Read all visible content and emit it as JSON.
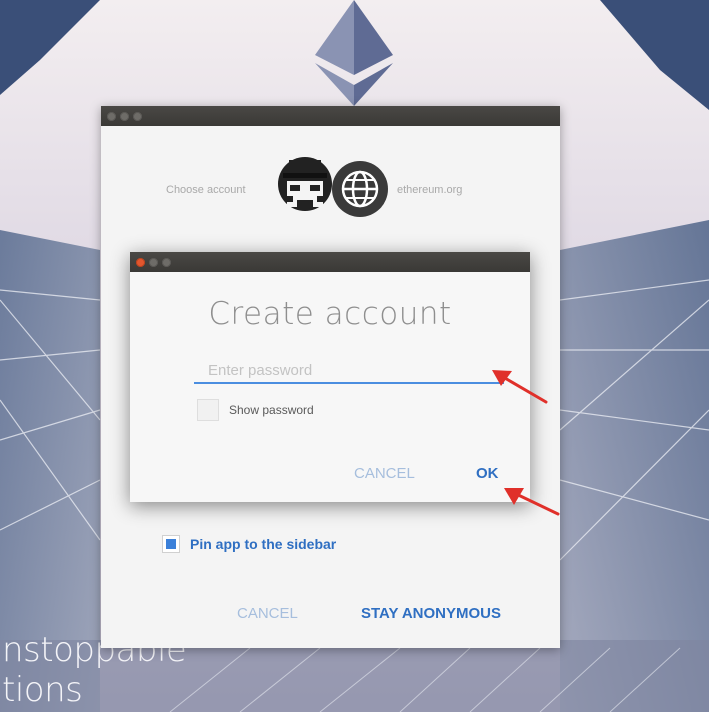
{
  "background": {
    "lines": [
      "nstoppable",
      "tions"
    ]
  },
  "outer_window": {
    "choose_account_label": "Choose account",
    "ethereum_label": "ethereum.org",
    "pin_label": "Pin app to the sidebar",
    "pin_checked": true,
    "cancel_label": "CANCEL",
    "stay_anonymous_label": "STAY ANONYMOUS",
    "icons": [
      "spy-avatar-icon",
      "globe-icon",
      "ethereum-logo-icon"
    ]
  },
  "dialog": {
    "title": "Create account",
    "password_placeholder": "Enter password",
    "password_value": "",
    "show_password_label": "Show password",
    "show_password_checked": false,
    "cancel_label": "CANCEL",
    "ok_label": "OK"
  },
  "annotations": {
    "arrow_color": "#e0302a",
    "arrows": [
      "arrow-to-password-field",
      "arrow-to-ok-button"
    ]
  },
  "colors": {
    "accent": "#2f6fc2",
    "titlebar": "#3e3d3a",
    "close_button": "#e2562e"
  }
}
